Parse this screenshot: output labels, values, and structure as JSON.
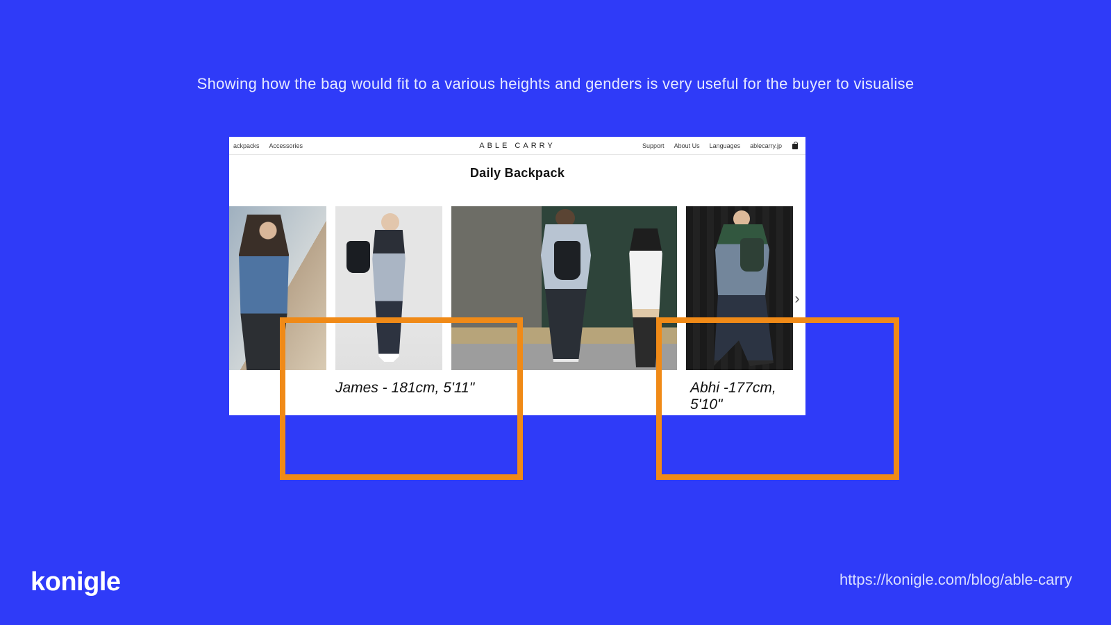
{
  "headline": "Showing how the bag would fit to a various heights and genders is very useful for the buyer to visualise",
  "shot": {
    "nav_left": [
      "ackpacks",
      "Accessories"
    ],
    "brand": "ABLE CARRY",
    "nav_right": [
      "Support",
      "About Us",
      "Languages",
      "ablecarry.jp"
    ],
    "product_title": "Daily Backpack",
    "captions": {
      "james": "James - 181cm, 5'11\"",
      "abhi": "Abhi -177cm, 5'10\""
    }
  },
  "footer": {
    "logo": "konigle",
    "url": "https://konigle.com/blog/able-carry"
  }
}
